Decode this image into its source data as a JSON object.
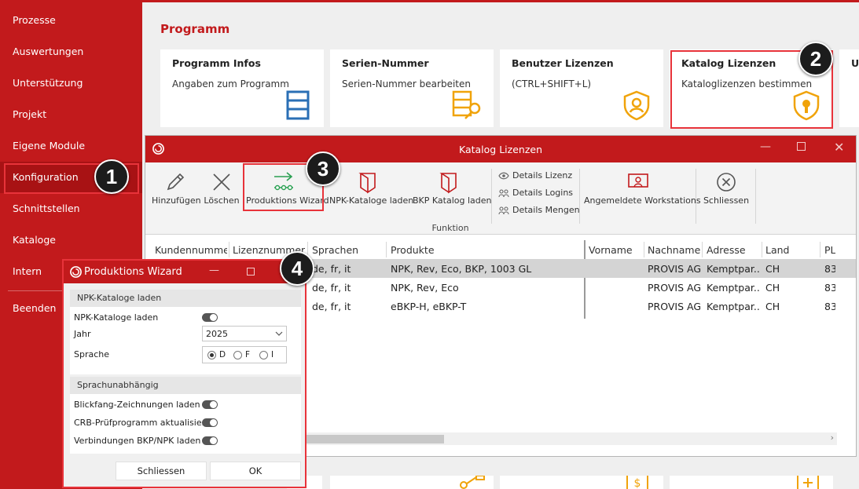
{
  "sidebar": {
    "items": [
      {
        "label": "Prozesse"
      },
      {
        "label": "Auswertungen"
      },
      {
        "label": "Unterstützung"
      },
      {
        "label": "Projekt"
      },
      {
        "label": "Eigene Module"
      },
      {
        "label": "Konfiguration"
      },
      {
        "label": "Schnittstellen"
      },
      {
        "label": "Kataloge"
      },
      {
        "label": "Intern"
      },
      {
        "label": "Beenden"
      }
    ]
  },
  "main": {
    "title": "Programm",
    "tiles": [
      {
        "title": "Programm Infos",
        "desc": "Angaben zum Programm",
        "icon": "list-icon"
      },
      {
        "title": "Serien-Nummer",
        "desc": "Serien-Nummer bearbeiten",
        "icon": "key-database-icon"
      },
      {
        "title": "Benutzer Lizenzen",
        "desc": "(CTRL+SHIFT+L)",
        "icon": "user-shield-icon"
      },
      {
        "title": "Katalog Lizenzen",
        "desc": "Kataloglizenzen bestimmen",
        "icon": "lock-shield-icon"
      },
      {
        "title": "U",
        "desc": "",
        "icon": ""
      }
    ]
  },
  "katalog_window": {
    "title": "Katalog Lizenzen",
    "ribbon": {
      "buttons": [
        {
          "label": "Hinzufügen",
          "icon": "pencil-icon"
        },
        {
          "label": "Löschen",
          "icon": "delete-x-icon"
        },
        {
          "label": "Produktions Wizard",
          "icon": "wizard-arrow-icon"
        },
        {
          "label": "NPK-Kataloge laden",
          "icon": "catalog-icon"
        },
        {
          "label": "BKP Katalog laden",
          "icon": "catalog-icon"
        },
        {
          "label": "Angemeldete Workstations",
          "icon": "workstation-icon"
        },
        {
          "label": "Schliessen",
          "icon": "close-circle-icon"
        }
      ],
      "small_buttons": [
        {
          "label": "Details Lizenz",
          "icon": "eye-icon"
        },
        {
          "label": "Details Logins",
          "icon": "users-icon"
        },
        {
          "label": "Details Mengen",
          "icon": "users-icon"
        }
      ],
      "group_label": "Funktion"
    },
    "grid": {
      "columns": [
        "Kundennummer",
        "Lizenznummer",
        "Sprachen",
        "Produkte",
        "Vorname",
        "Nachname",
        "Adresse",
        "Land",
        "PLZ"
      ],
      "rows": [
        {
          "sprachen": "de, fr, it",
          "produkte": "NPK, Rev, Eco, BKP, 1003 GL",
          "vorname": "",
          "nachname": "PROVIS AG",
          "adresse": "Kemptpar...",
          "land": "CH",
          "plz": "83"
        },
        {
          "sprachen": "de, fr, it",
          "produkte": "NPK, Rev, Eco",
          "vorname": "",
          "nachname": "PROVIS AG",
          "adresse": "Kemptpar...",
          "land": "CH",
          "plz": "83"
        },
        {
          "sprachen": "de, fr, it",
          "produkte": "eBKP-H, eBKP-T",
          "vorname": "",
          "nachname": "PROVIS AG",
          "adresse": "Kemptpar...",
          "land": "CH",
          "plz": "83"
        }
      ]
    }
  },
  "wizard": {
    "title": "Produktions Wizard",
    "section1": {
      "header": "NPK-Kataloge laden",
      "npk_label": "NPK-Kataloge laden",
      "jahr_label": "Jahr",
      "jahr_value": "2025",
      "sprache_label": "Sprache",
      "sprache_options": [
        "D",
        "F",
        "I"
      ],
      "sprache_selected": "D"
    },
    "section2": {
      "header": "Sprachunabhängig",
      "items": [
        {
          "label": "Blickfang-Zeichnungen laden"
        },
        {
          "label": "CRB-Prüfprogramm aktualisieren"
        },
        {
          "label": "Verbindungen BKP/NPK laden"
        }
      ]
    },
    "buttons": {
      "close": "Schliessen",
      "ok": "OK"
    }
  },
  "annotations": [
    "1",
    "2",
    "3",
    "4"
  ],
  "colors": {
    "brand_red": "#c21a1c",
    "highlight_red": "#e8333a",
    "icon_orange": "#f0a30a",
    "icon_blue": "#2a6fb5"
  }
}
